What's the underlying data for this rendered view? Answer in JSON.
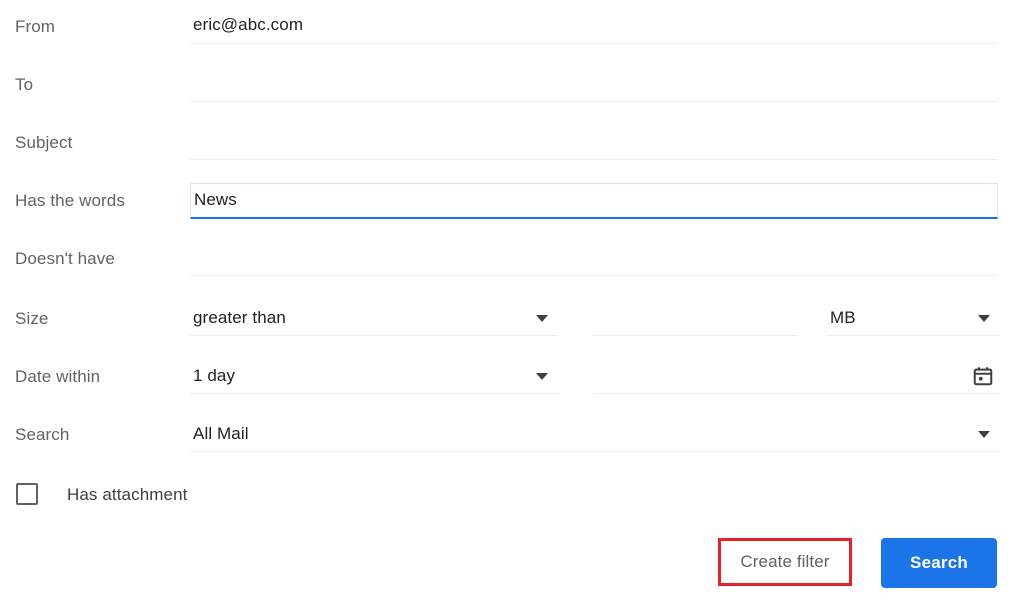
{
  "colors": {
    "accent_blue": "#1b74e8",
    "focus_underline": "#1a73e8",
    "highlight_red": "#e8202a",
    "label_gray": "#5f6368",
    "value_dark": "#202124"
  },
  "form": {
    "rows": [
      {
        "label": "From",
        "value": "eric@abc.com",
        "placeholder": ""
      },
      {
        "label": "To",
        "value": "",
        "placeholder": ""
      },
      {
        "label": "Subject",
        "value": "",
        "placeholder": ""
      },
      {
        "label": "Has the words",
        "value": "News",
        "placeholder": ""
      },
      {
        "label": "Doesn't have",
        "value": "",
        "placeholder": ""
      }
    ],
    "size_row": {
      "label": "Size",
      "comparator": "greater than",
      "amount": "",
      "amount_placeholder": "",
      "unit": "MB"
    },
    "date_row": {
      "label": "Date within",
      "range": "1 day",
      "date": "",
      "date_placeholder": "",
      "calendar_icon": "calendar-icon"
    },
    "search_scope_row": {
      "label": "Search",
      "scope": "All Mail"
    },
    "attachment": {
      "label": "Has attachment",
      "checked": false
    }
  },
  "actions": {
    "create_filter_label": "Create filter",
    "search_label": "Search"
  },
  "icons": {
    "dropdown": "chevron-down-icon"
  }
}
